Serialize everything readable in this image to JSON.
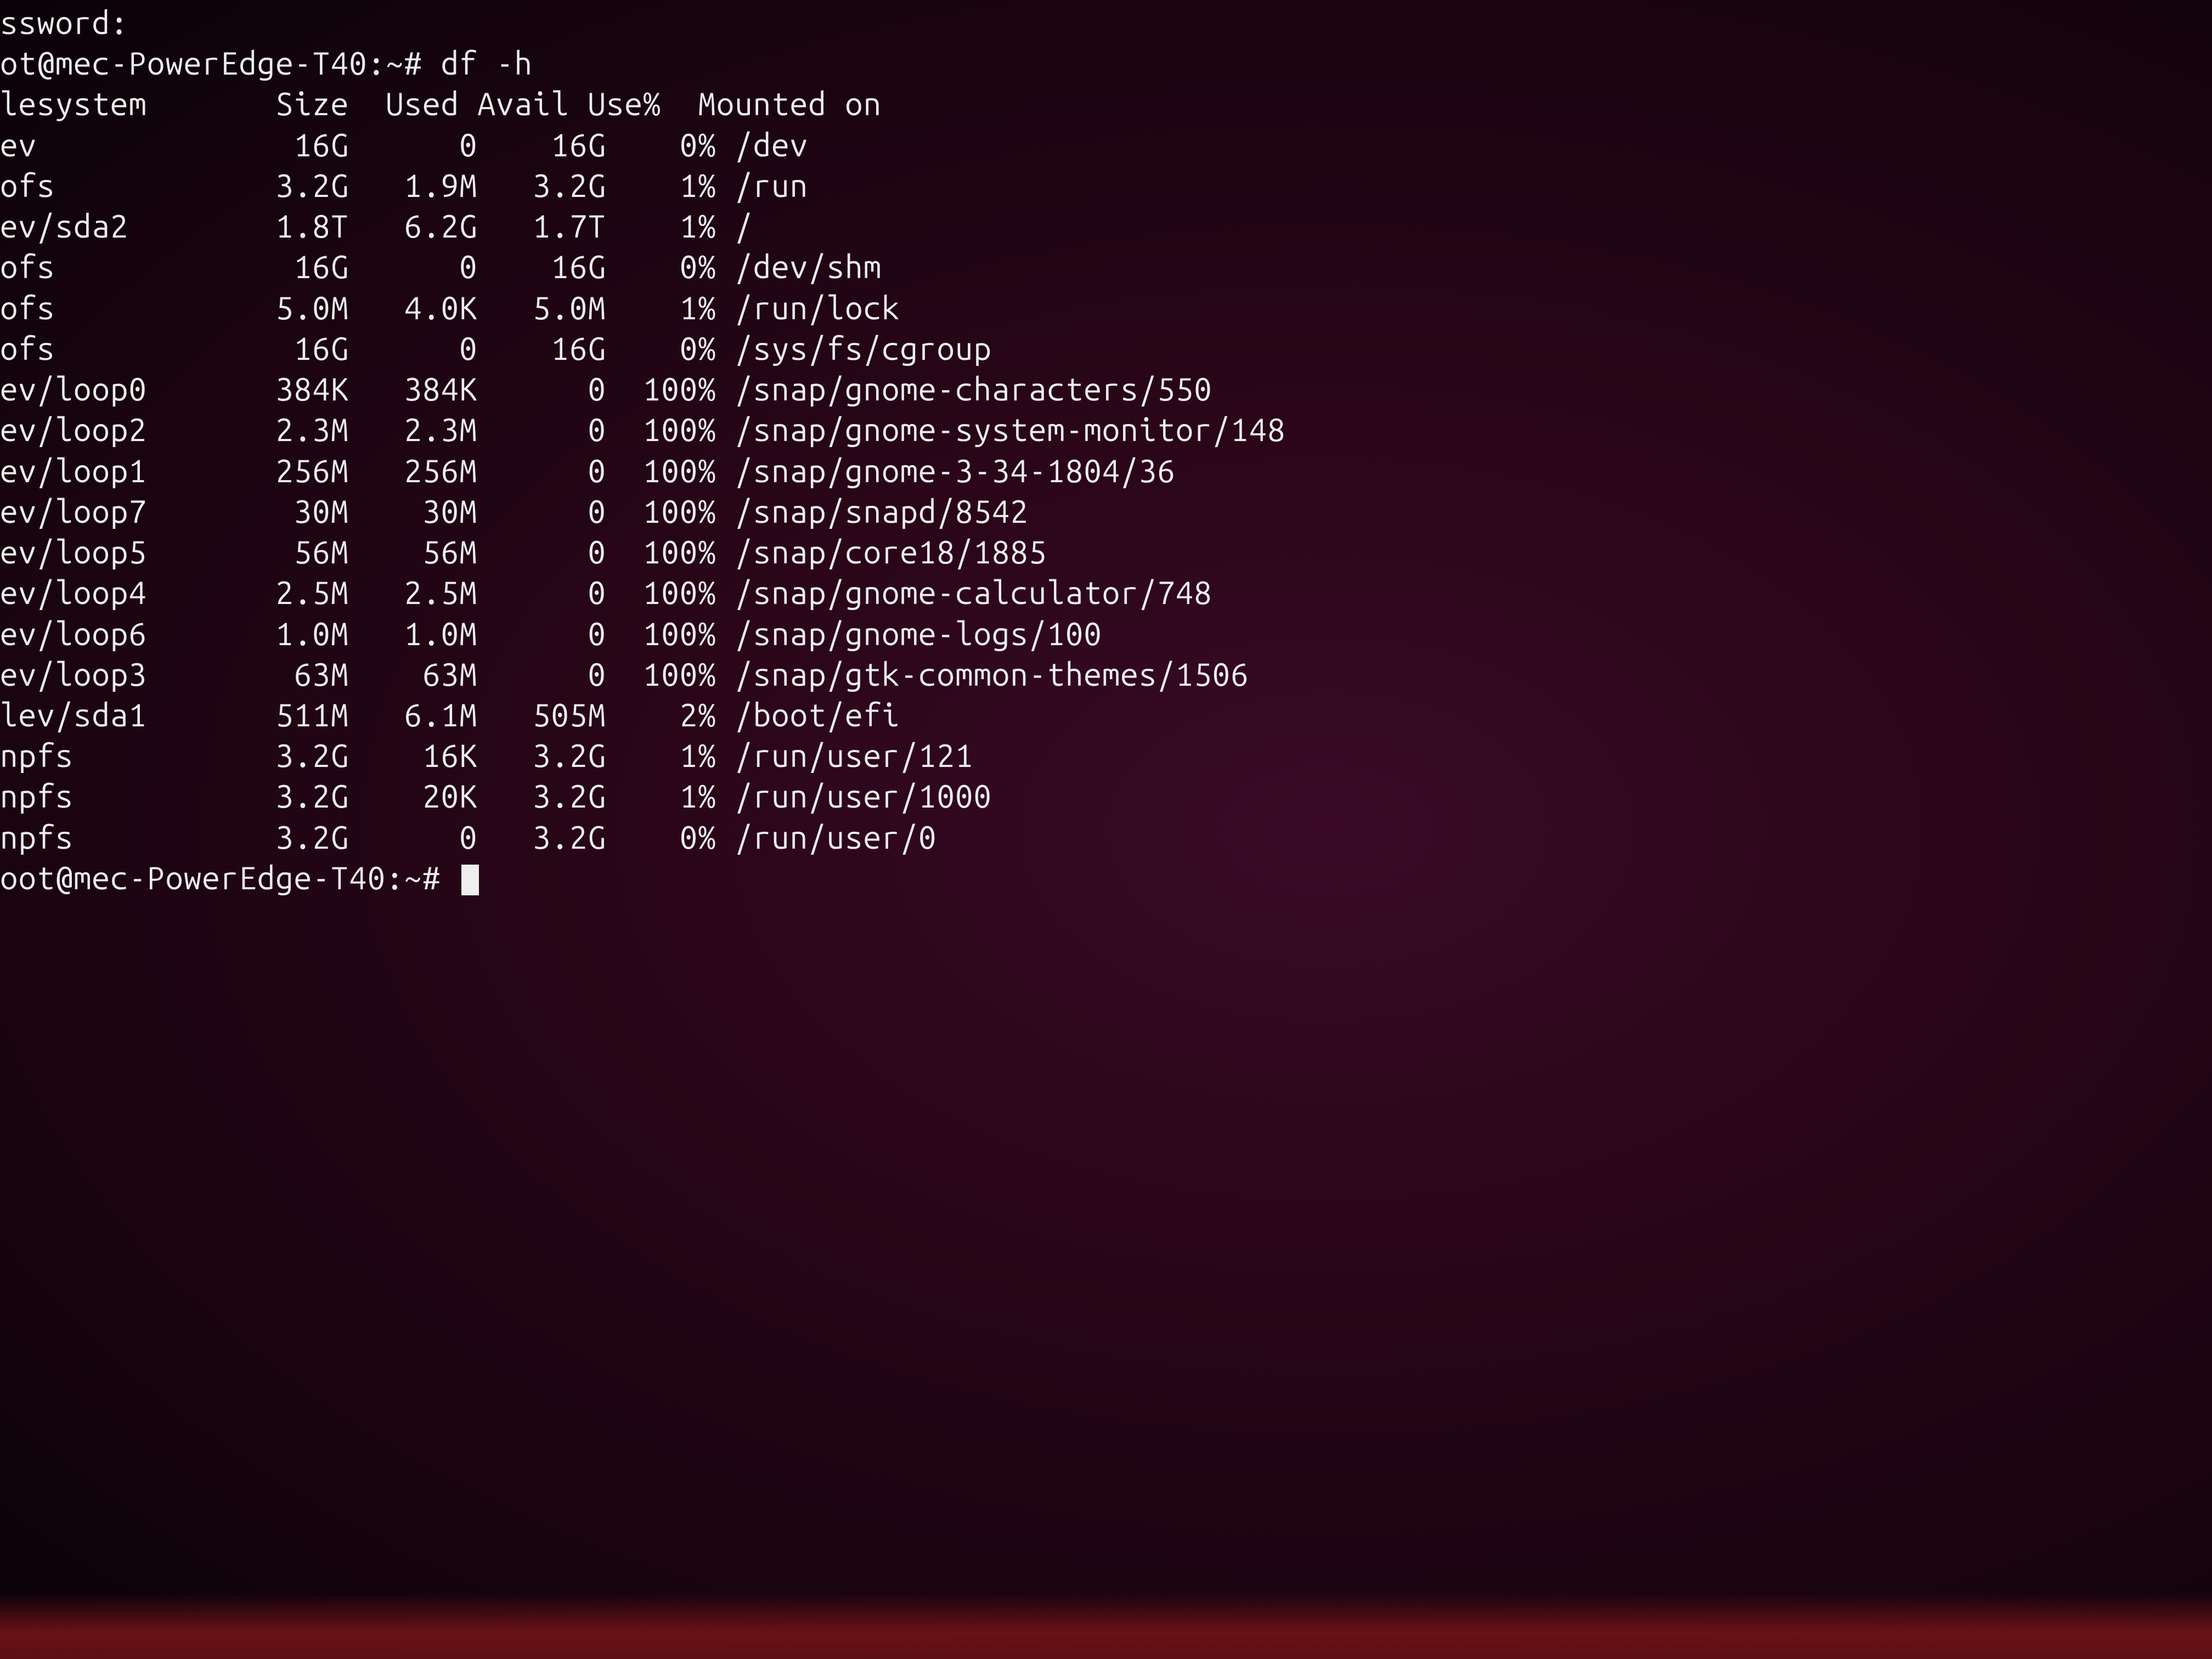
{
  "lines": {
    "password_fragment": "ssword:",
    "prompt_cmd": "ot@mec-PowerEdge-T40:~# df -h",
    "prompt_end": "oot@mec-PowerEdge-T40:~# "
  },
  "header": {
    "filesystem": "lesystem",
    "size": "Size",
    "used": "Used",
    "avail": "Avail",
    "use_pct": "Use%",
    "mounted": "Mounted on"
  },
  "rows": [
    {
      "fs": "ev",
      "size": "16G",
      "used": "0",
      "avail": "16G",
      "pct": "0%",
      "mnt": "/dev"
    },
    {
      "fs": "ofs",
      "size": "3.2G",
      "used": "1.9M",
      "avail": "3.2G",
      "pct": "1%",
      "mnt": "/run"
    },
    {
      "fs": "ev/sda2",
      "size": "1.8T",
      "used": "6.2G",
      "avail": "1.7T",
      "pct": "1%",
      "mnt": "/"
    },
    {
      "fs": "ofs",
      "size": "16G",
      "used": "0",
      "avail": "16G",
      "pct": "0%",
      "mnt": "/dev/shm"
    },
    {
      "fs": "ofs",
      "size": "5.0M",
      "used": "4.0K",
      "avail": "5.0M",
      "pct": "1%",
      "mnt": "/run/lock"
    },
    {
      "fs": "ofs",
      "size": "16G",
      "used": "0",
      "avail": "16G",
      "pct": "0%",
      "mnt": "/sys/fs/cgroup"
    },
    {
      "fs": "ev/loop0",
      "size": "384K",
      "used": "384K",
      "avail": "0",
      "pct": "100%",
      "mnt": "/snap/gnome-characters/550"
    },
    {
      "fs": "ev/loop2",
      "size": "2.3M",
      "used": "2.3M",
      "avail": "0",
      "pct": "100%",
      "mnt": "/snap/gnome-system-monitor/148"
    },
    {
      "fs": "ev/loop1",
      "size": "256M",
      "used": "256M",
      "avail": "0",
      "pct": "100%",
      "mnt": "/snap/gnome-3-34-1804/36"
    },
    {
      "fs": "ev/loop7",
      "size": "30M",
      "used": "30M",
      "avail": "0",
      "pct": "100%",
      "mnt": "/snap/snapd/8542"
    },
    {
      "fs": "ev/loop5",
      "size": "56M",
      "used": "56M",
      "avail": "0",
      "pct": "100%",
      "mnt": "/snap/core18/1885"
    },
    {
      "fs": "ev/loop4",
      "size": "2.5M",
      "used": "2.5M",
      "avail": "0",
      "pct": "100%",
      "mnt": "/snap/gnome-calculator/748"
    },
    {
      "fs": "ev/loop6",
      "size": "1.0M",
      "used": "1.0M",
      "avail": "0",
      "pct": "100%",
      "mnt": "/snap/gnome-logs/100"
    },
    {
      "fs": "ev/loop3",
      "size": "63M",
      "used": "63M",
      "avail": "0",
      "pct": "100%",
      "mnt": "/snap/gtk-common-themes/1506"
    },
    {
      "fs": "lev/sda1",
      "size": "511M",
      "used": "6.1M",
      "avail": "505M",
      "pct": "2%",
      "mnt": "/boot/efi"
    },
    {
      "fs": "npfs",
      "size": "3.2G",
      "used": "16K",
      "avail": "3.2G",
      "pct": "1%",
      "mnt": "/run/user/121"
    },
    {
      "fs": "npfs",
      "size": "3.2G",
      "used": "20K",
      "avail": "3.2G",
      "pct": "1%",
      "mnt": "/run/user/1000"
    },
    {
      "fs": "npfs",
      "size": "3.2G",
      "used": "0",
      "avail": "3.2G",
      "pct": "0%",
      "mnt": "/run/user/0"
    }
  ],
  "col_widths": {
    "fs": 13,
    "size": 6,
    "used": 6,
    "avail": 6,
    "pct": 5
  }
}
